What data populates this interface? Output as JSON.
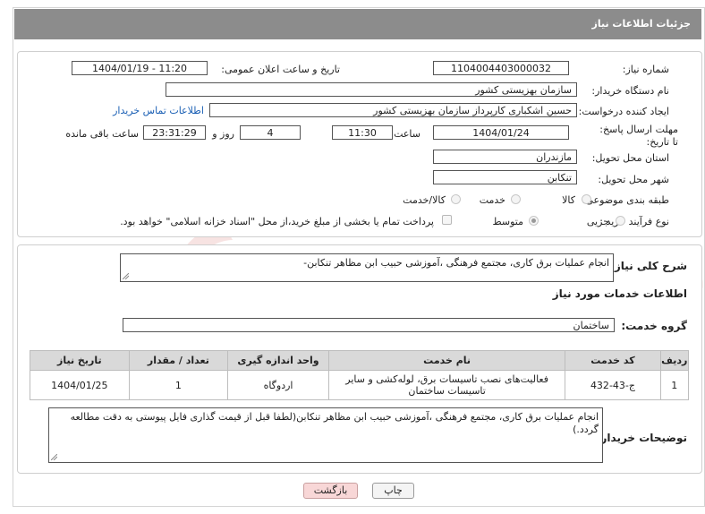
{
  "header": {
    "title": "جزئیات اطلاعات نیاز"
  },
  "fields": {
    "need_number_label": "شماره نیاز:",
    "need_number": "1104004403000032",
    "announce_label": "تاریخ و ساعت اعلان عمومی:",
    "announce_value": "1404/01/19 - 11:20",
    "buyer_org_label": "نام دستگاه خریدار:",
    "buyer_org": "سازمان بهزیستی کشور",
    "creator_label": "ایجاد کننده درخواست:",
    "creator": "حسین اشکباری کارپرداز سازمان بهزیستی کشور",
    "contact_link": "اطلاعات تماس خریدار",
    "deadline_label": "مهلت ارسال پاسخ: تا تاریخ:",
    "deadline_date": "1404/01/24",
    "time_label": "ساعت",
    "deadline_time": "11:30",
    "days_value": "4",
    "days_label": "روز و",
    "remaining_time": "23:31:29",
    "remaining_label": "ساعت باقی مانده",
    "province_label": "استان محل تحویل:",
    "province": "مازندران",
    "city_label": "شهر محل تحویل:",
    "city": "تنکابن",
    "category_label": "طبقه بندی موضوعی:",
    "category_options": [
      "کالا",
      "خدمت",
      "کالا/خدمت"
    ],
    "process_label": "نوع فرآیند خرید :",
    "process_options": [
      "جزیی",
      "متوسط"
    ],
    "payment_text": "پرداخت تمام یا بخشی از مبلغ خرید،از محل \"اسناد خزانه اسلامی\" خواهد بود."
  },
  "summary": {
    "label": "شرح کلی نیاز:",
    "value": "انجام عملیات برق کاری،  مجتمع فرهنگی ،آموزشی حبیب ابن مظاهر تنکابن-"
  },
  "services": {
    "section_title": "اطلاعات خدمات مورد نیاز",
    "group_label": "گروه خدمت:",
    "group_value": "ساختمان",
    "columns": [
      "ردیف",
      "کد خدمت",
      "نام خدمت",
      "واحد اندازه گیری",
      "تعداد / مقدار",
      "تاریخ نیاز"
    ],
    "rows": [
      {
        "index": "1",
        "code": "ج-43-432",
        "name": "فعالیت‌های نصب تاسیسات برق، لوله‌کشی و سایر تاسیسات ساختمان",
        "unit": "اردوگاه",
        "qty": "1",
        "date": "1404/01/25"
      }
    ]
  },
  "buyer_notes": {
    "label": "توضیحات خریدار:",
    "value": "انجام عملیات برق کاری،  مجتمع فرهنگی ،آموزشی حبیب ابن مظاهر تنکابن(لطفا قبل از قیمت گذاری فایل پیوستی به دقت مطالعه گردد.)"
  },
  "buttons": {
    "print": "چاپ",
    "back": "بازگشت"
  },
  "colors": {
    "header_bg": "#8c8c8c",
    "back_btn_bg": "#f8d7d7",
    "link": "#1a5fb4"
  }
}
